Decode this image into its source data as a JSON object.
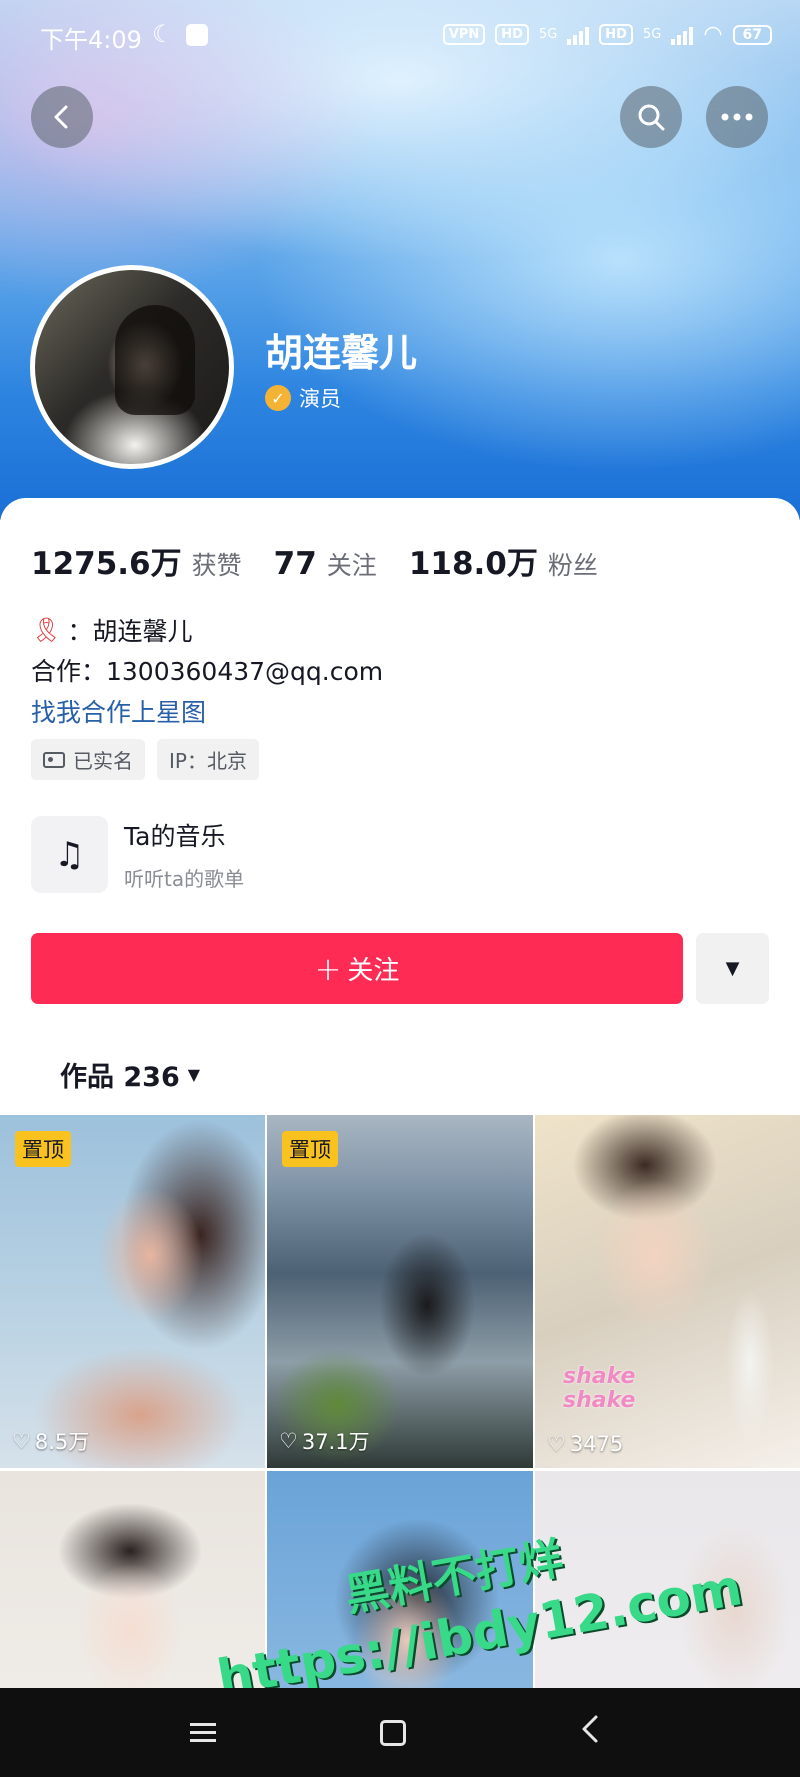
{
  "status_bar": {
    "time": "下午4:09",
    "vpn": "VPN",
    "hd1": "HD",
    "net1": "5G",
    "hd2": "HD",
    "net2": "5G",
    "battery": "67"
  },
  "header": {
    "back_icon": "chevron-left-icon",
    "search_icon": "search-icon",
    "more_icon": "more-dots-icon"
  },
  "profile": {
    "name": "胡连馨儿",
    "verified_label": "演员",
    "verified_color": "#f5b335"
  },
  "stats": [
    {
      "value": "1275.6万",
      "label": "获赞"
    },
    {
      "value": "77",
      "label": "关注"
    },
    {
      "value": "118.0万",
      "label": "粉丝"
    }
  ],
  "bio": {
    "name_line": "：胡连馨儿",
    "coop_line": "合作：1300360437@qq.com",
    "link_text": "找我合作上星图",
    "link_color": "#275fa8"
  },
  "tags": {
    "verified": "已实名",
    "ip": "IP：北京"
  },
  "music": {
    "title": "Ta的音乐",
    "subtitle": "听听ta的歌单"
  },
  "follow": {
    "plus": "+",
    "label": "关注",
    "color": "#fe2c55",
    "dropdown_icon": "▼"
  },
  "works": {
    "label": "作品 236",
    "caret": "▼"
  },
  "videos": [
    {
      "pinned": true,
      "pin_label": "置顶",
      "likes": "8.5万"
    },
    {
      "pinned": true,
      "pin_label": "置顶",
      "likes": "37.1万"
    },
    {
      "pinned": false,
      "likes": "3475",
      "overlay": "shake\nshake"
    },
    {
      "pinned": false
    },
    {
      "pinned": false
    },
    {
      "pinned": false
    }
  ],
  "watermark": {
    "line1": "黑料不打烊",
    "line2": "https://ibdy12.com"
  }
}
